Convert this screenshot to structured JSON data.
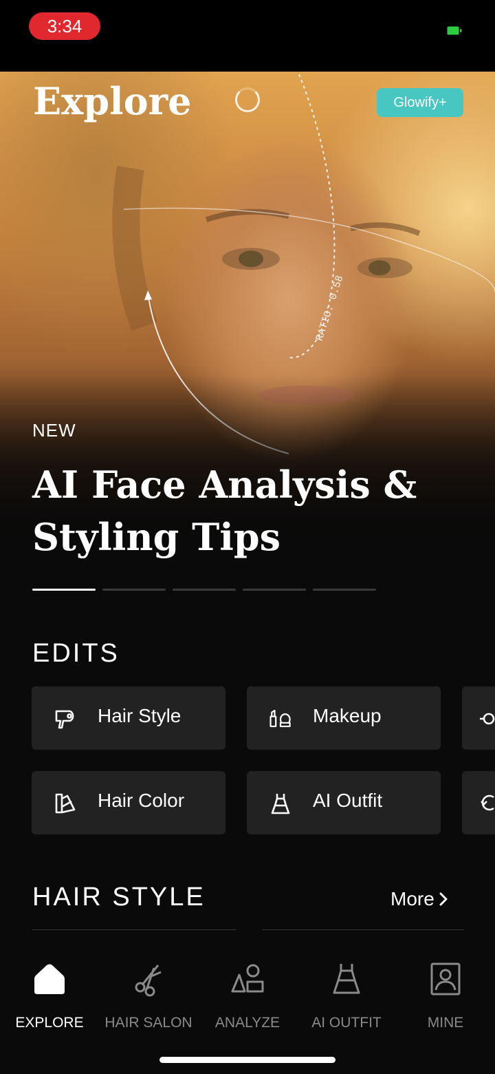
{
  "status_bar": {
    "time": "3:34"
  },
  "header": {
    "title": "Explore",
    "badge": "Glowify+"
  },
  "hero": {
    "tag": "NEW",
    "title": "AI Face Analysis & Styling Tips",
    "overlay_text": "RATIO: 0.58",
    "slides_total": 5,
    "active_slide": 1
  },
  "edits": {
    "title": "EDITS",
    "buttons": [
      {
        "label": "Hair Style",
        "icon": "hair-dryer-icon"
      },
      {
        "label": "Makeup",
        "icon": "makeup-icon"
      },
      {
        "label": "Hair Color",
        "icon": "color-swatch-icon"
      },
      {
        "label": "AI Outfit",
        "icon": "dress-icon"
      }
    ]
  },
  "hair_style": {
    "title": "HAIR STYLE",
    "more": "More"
  },
  "tabbar": {
    "tabs": [
      {
        "label": "EXPLORE",
        "icon": "home-icon",
        "active": true
      },
      {
        "label": "HAIR SALON",
        "icon": "scissors-icon",
        "active": false
      },
      {
        "label": "ANALYZE",
        "icon": "shapes-icon",
        "active": false
      },
      {
        "label": "AI OUTFIT",
        "icon": "dress-icon",
        "active": false
      },
      {
        "label": "MINE",
        "icon": "profile-icon",
        "active": false
      }
    ]
  },
  "colors": {
    "accent_badge": "#47c6c2",
    "time_pill": "#e0282e",
    "button_bg": "#222222",
    "background": "#0a0a0a"
  }
}
